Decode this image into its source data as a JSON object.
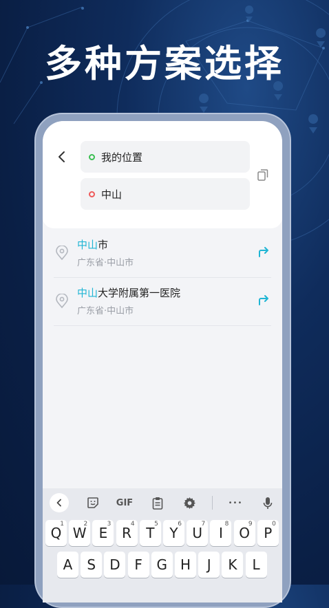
{
  "headline": "多种方案选择",
  "route": {
    "origin": "我的位置",
    "destination": "中山"
  },
  "results": [
    {
      "highlight": "中山",
      "rest": "市",
      "sub": "广东省·中山市"
    },
    {
      "highlight": "中山",
      "rest": "大学附属第一医院",
      "sub": "广东省·中山市"
    }
  ],
  "keyboard": {
    "toolbar": {
      "gif": "GIF",
      "more": "•••"
    },
    "row1": [
      {
        "key": "Q",
        "num": "1"
      },
      {
        "key": "W",
        "num": "2"
      },
      {
        "key": "E",
        "num": "3"
      },
      {
        "key": "R",
        "num": "4"
      },
      {
        "key": "T",
        "num": "5"
      },
      {
        "key": "Y",
        "num": "6"
      },
      {
        "key": "U",
        "num": "7"
      },
      {
        "key": "I",
        "num": "8"
      },
      {
        "key": "O",
        "num": "9"
      },
      {
        "key": "P",
        "num": "0"
      }
    ],
    "row2": [
      "A",
      "S",
      "D",
      "F",
      "G",
      "H",
      "J",
      "K",
      "L"
    ]
  },
  "colors": {
    "highlight": "#1fb5d4",
    "origin_dot": "#3bbf52",
    "destination_dot": "#ef5a5a",
    "background": "#0f2c5c"
  }
}
